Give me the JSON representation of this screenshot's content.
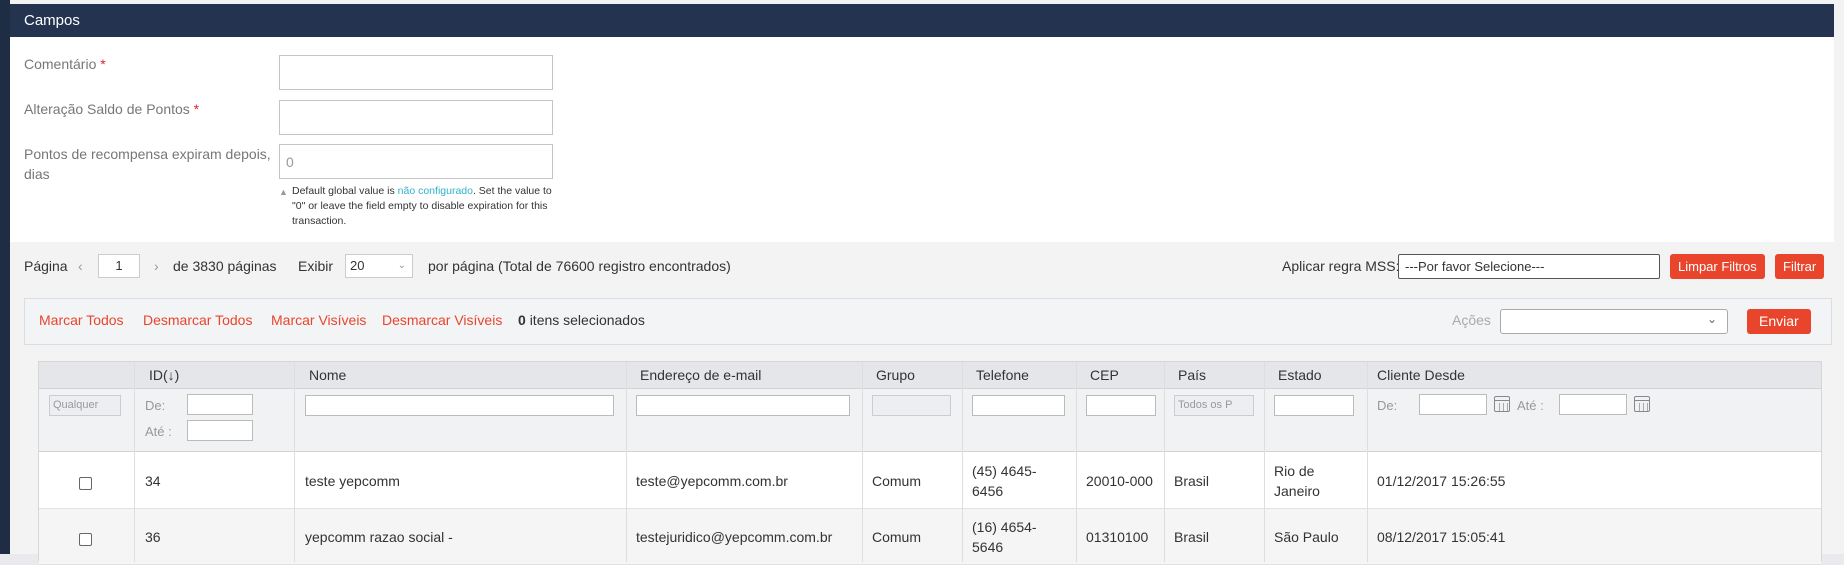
{
  "fieldset": {
    "title": "Campos",
    "comment_label": "Comentário",
    "points_label": "Alteração Saldo de Pontos",
    "expire_label_1": "Pontos de recompensa expiram depois,",
    "expire_label_2": "dias",
    "required_mark": "*",
    "comment_value": "",
    "points_value": "",
    "expire_value": "0",
    "hint_pre": "Default global value is ",
    "hint_link": "não configurado",
    "hint_post": ". Set the value to \"0\" or leave the field empty to disable expiration for this transaction."
  },
  "pager": {
    "page_label": "Página",
    "page_value": "1",
    "of_label": "de",
    "total_pages": "3830",
    "pages_label": "páginas",
    "show_label": "Exibir",
    "per_page_value": "20",
    "per_page_text": "por página (Total de",
    "total_records": "76600",
    "records_text": "registro encontrados)",
    "mss_label": "Aplicar regra MSS:",
    "mss_select": "---Por favor Selecione---",
    "clear_filters": "Limpar Filtros",
    "filter": "Filtrar"
  },
  "massaction": {
    "select_all": "Marcar Todos",
    "unselect_all": "Desmarcar Todos",
    "select_visible": "Marcar Visíveis",
    "unselect_visible": "Desmarcar Visíveis",
    "selected_count": "0",
    "selected_text": "itens selecionados",
    "actions_label": "Ações",
    "actions_value": "",
    "submit": "Enviar"
  },
  "grid": {
    "headers": {
      "id": "ID",
      "name": "Nome",
      "email": "Endereço de e-mail",
      "group": "Grupo",
      "phone": "Telefone",
      "zip": "CEP",
      "country": "País",
      "state": "Estado",
      "since": "Cliente Desde"
    },
    "sort_indicator": "(↓)",
    "filters": {
      "any": "Qualquer",
      "from": "De:",
      "to": "Até :",
      "country_placeholder": "Todos os P",
      "date_from": "De:",
      "date_to": "Até :"
    },
    "rows": [
      {
        "id": "34",
        "name": "teste yepcomm",
        "email": "teste@yepcomm.com.br",
        "group": "Comum",
        "phone_1": "(45) 4645-",
        "phone_2": "6456",
        "zip": "20010-000",
        "country": "Brasil",
        "state_1": "Rio de",
        "state_2": "Janeiro",
        "since": "01/12/2017 15:26:55"
      },
      {
        "id": "36",
        "name": "yepcomm razao social -",
        "email": "testejuridico@yepcomm.com.br",
        "group": "Comum",
        "phone_1": "(16) 4654-",
        "phone_2": "5646",
        "zip": "01310100",
        "country": "Brasil",
        "state_1": "São Paulo",
        "state_2": "",
        "since": "08/12/2017 15:05:41"
      }
    ]
  },
  "colors": {
    "header_bg": "#243450",
    "accent": "#e8452c",
    "link_blue": "#2eb3c8"
  }
}
